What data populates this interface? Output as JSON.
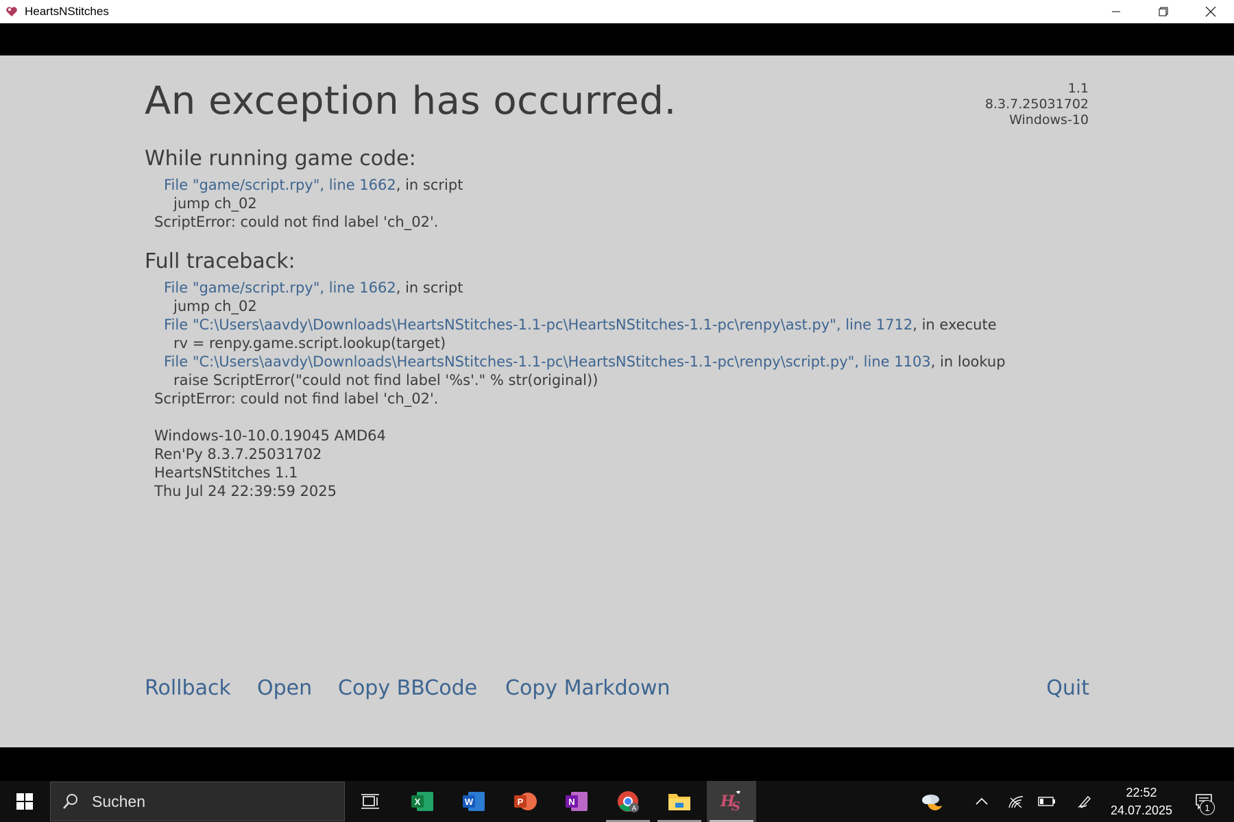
{
  "window": {
    "title": "HeartsNStitches",
    "icons": {
      "app": "heart-app-icon",
      "minimize": "minimize-icon",
      "restore": "restore-icon",
      "close": "close-icon"
    }
  },
  "error": {
    "heading": "An exception has occurred.",
    "version_info": [
      "1.1",
      "8.3.7.25031702",
      "Windows-10"
    ],
    "while_running_title": "While running game code:",
    "while_running": {
      "file_link": "File \"game/script.rpy\", line 1662",
      "file_suffix": ", in script",
      "code": "jump ch_02",
      "error": "ScriptError: could not find label 'ch_02'."
    },
    "full_traceback_title": "Full traceback:",
    "traceback": [
      {
        "link": "File \"game/script.rpy\", line 1662",
        "suffix": ", in script",
        "code": "jump ch_02"
      },
      {
        "link": "File \"C:\\Users\\aavdy\\Downloads\\HeartsNStitches-1.1-pc\\HeartsNStitches-1.1-pc\\renpy\\ast.py\", line 1712",
        "suffix": ", in execute",
        "code": "rv = renpy.game.script.lookup(target)"
      },
      {
        "link": "File \"C:\\Users\\aavdy\\Downloads\\HeartsNStitches-1.1-pc\\HeartsNStitches-1.1-pc\\renpy\\script.py\", line 1103",
        "suffix": ", in lookup",
        "code": "raise ScriptError(\"could not find label '%s'.\" % str(original))"
      }
    ],
    "traceback_error": "ScriptError: could not find label 'ch_02'.",
    "system_info": [
      "Windows-10-10.0.19045 AMD64",
      "Ren'Py 8.3.7.25031702",
      "HeartsNStitches 1.1",
      "Thu Jul 24 22:39:59 2025"
    ]
  },
  "actions": {
    "rollback": "Rollback",
    "open": "Open",
    "copy_bbcode": "Copy BBCode",
    "copy_markdown": "Copy Markdown",
    "quit": "Quit"
  },
  "taskbar": {
    "search_placeholder": "Suchen",
    "apps": [
      "task-view-icon",
      "excel-icon",
      "word-icon",
      "powerpoint-icon",
      "onenote-icon",
      "chrome-icon",
      "file-explorer-icon",
      "heartsnstitches-icon"
    ],
    "tray_icons": [
      "weather-icon",
      "chevron-up-icon",
      "wifi-icon",
      "battery-icon",
      "pen-icon"
    ],
    "clock_time": "22:52",
    "clock_date": "24.07.2025",
    "notification_count": "1"
  },
  "colors": {
    "link": "#3d6591",
    "text": "#3c3c3c",
    "background": "#d1d1d1"
  }
}
